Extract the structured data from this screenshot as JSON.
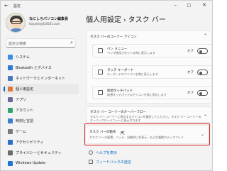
{
  "window": {
    "title": "設定"
  },
  "profile": {
    "name": "なにしろパソコン編集長",
    "email": "hoyashi@f24561.com"
  },
  "search": {
    "placeholder": "設定の検索"
  },
  "nav": [
    {
      "label": "システム",
      "icon": "system-icon",
      "color": "#3a8ee6"
    },
    {
      "label": "Bluetooth とデバイス",
      "icon": "bluetooth-icon",
      "color": "#2f7ad6"
    },
    {
      "label": "ネットワークとインターネット",
      "icon": "network-icon",
      "color": "#4a78c0"
    },
    {
      "label": "個人用設定",
      "icon": "personalization-icon",
      "color": "#e07a3c",
      "active": true
    },
    {
      "label": "アプリ",
      "icon": "apps-icon",
      "color": "#6a6a9a"
    },
    {
      "label": "アカウント",
      "icon": "account-icon",
      "color": "#2fa36b"
    },
    {
      "label": "時刻と言語",
      "icon": "time-language-icon",
      "color": "#3c7fd1"
    },
    {
      "label": "ゲーム",
      "icon": "gaming-icon",
      "color": "#7a7a7a"
    },
    {
      "label": "アクセシビリティ",
      "icon": "accessibility-icon",
      "color": "#2a6fd0"
    },
    {
      "label": "プライバシーとセキュリティ",
      "icon": "privacy-icon",
      "color": "#6b6b6b"
    },
    {
      "label": "Windows Update",
      "icon": "windows-update-icon",
      "color": "#1f75d4"
    }
  ],
  "breadcrumb": {
    "parent": "個人用設定",
    "separator": "›",
    "current": "タスク バー"
  },
  "cornerIcons": {
    "title": "タスク バーのコーナー アイコン",
    "rows": [
      {
        "title": "ペン メニュー",
        "desc": "ペンが使用されている時に表示します",
        "state": "オフ"
      },
      {
        "title": "タッチ キーボード",
        "desc": "キーボードのアイコンを常に表示します",
        "state": "オフ"
      },
      {
        "title": "仮想タッチパッド",
        "desc": "仮想タッチパッドのアイコンを常に表示します",
        "state": "オフ"
      }
    ]
  },
  "overflow": {
    "title": "タスク バー コーナーのオーバーフロー",
    "desc": "タスク バー コーナーに表示するアイコンを選択してください。タスク バー コーナーの",
    "desc2": "オーバーフローメニューに表示されます"
  },
  "behaviors": {
    "title": "タスク バーの動作",
    "desc": "タスク バーの配置、バッジ、自動的に非表示、および複数のディスプレイ"
  },
  "links": {
    "help": "ヘルプを表示",
    "feedback": "フィードバックの送信"
  },
  "colors": {
    "accent": "#0067c0",
    "highlight": "#e02020"
  }
}
